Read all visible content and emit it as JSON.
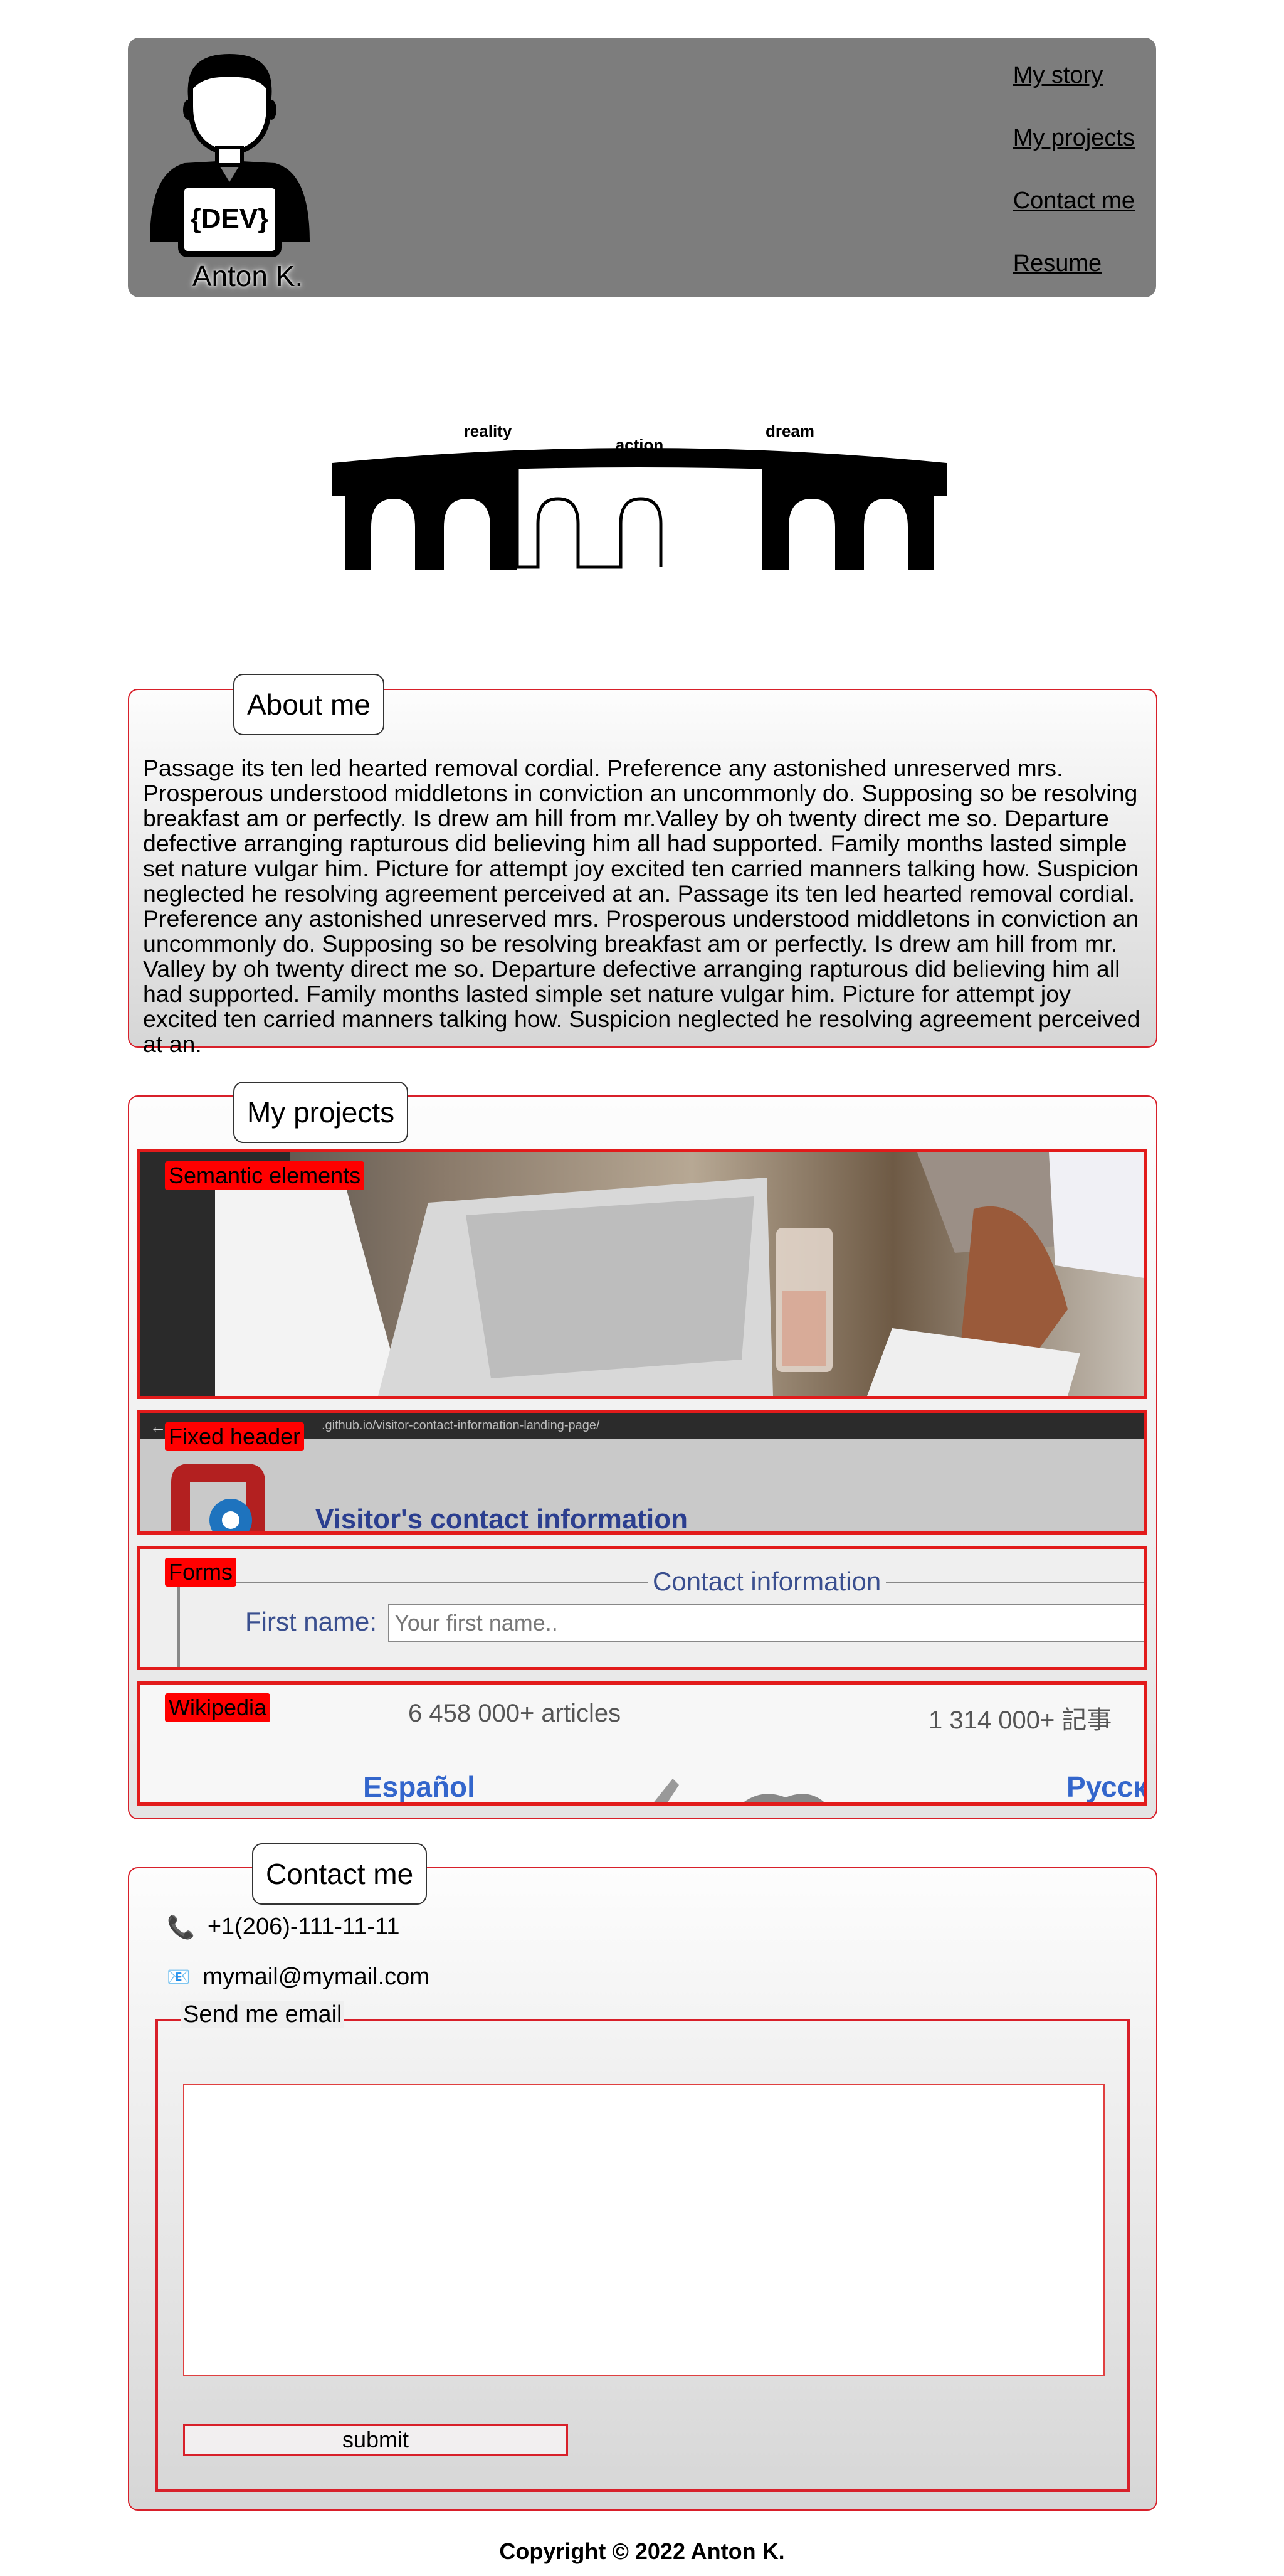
{
  "header": {
    "avatar_badge": "{DEV}",
    "name": "Anton K.",
    "nav": [
      "My story",
      "My projects",
      "Contact me",
      "Resume"
    ]
  },
  "bridge": {
    "labels": [
      "reality",
      "action",
      "dream"
    ]
  },
  "about": {
    "title": "About me",
    "text": "Passage its ten led hearted removal cordial. Preference any astonished unreserved mrs. Prosperous understood middletons in conviction an uncommonly do. Supposing so be resolving breakfast am or perfectly. Is drew am hill from mr.Valley by oh twenty direct me so. Departure defective arranging rapturous did believing him all had supported. Family months lasted simple set nature vulgar him. Picture for attempt joy excited ten carried manners talking how. Suspicion neglected he resolving agreement perceived at an. Passage its ten led hearted removal cordial. Preference any astonished unreserved mrs. Prosperous understood middletons in conviction an uncommonly do. Supposing so be resolving breakfast am or perfectly. Is drew am hill from mr. Valley by oh twenty direct me so. Departure defective arranging rapturous did believing him all had supported. Family months lasted simple set nature vulgar him. Picture for attempt joy excited ten carried manners talking how. Suspicion neglected he resolving agreement perceived at an."
  },
  "projects": {
    "title": "My projects",
    "cards": [
      {
        "label": "Semantic elements"
      },
      {
        "label": "Fixed header",
        "url": ".github.io/visitor-contact-information-landing-page/",
        "heading": "Visitor's contact information"
      },
      {
        "label": "Forms",
        "legend": "Contact information",
        "field_label": "First name:",
        "placeholder": "Your first name.."
      },
      {
        "label": "Wikipedia",
        "left_count": "6 458 000+ articles",
        "right_count": "1 314 000+ 記事",
        "left_lang": "Español",
        "right_lang": "Русск"
      }
    ]
  },
  "contact": {
    "title": "Contact me",
    "phone": "+1(206)-111-11-11",
    "email": "mymail@mymail.com",
    "form_legend": "Send me email",
    "submit": "submit"
  },
  "footer": {
    "copyright": "Copyright © 2022 Anton K."
  },
  "colors": {
    "header_bg": "#7d7d7d",
    "accent": "#d8202a",
    "label_bg": "#ff0000"
  }
}
